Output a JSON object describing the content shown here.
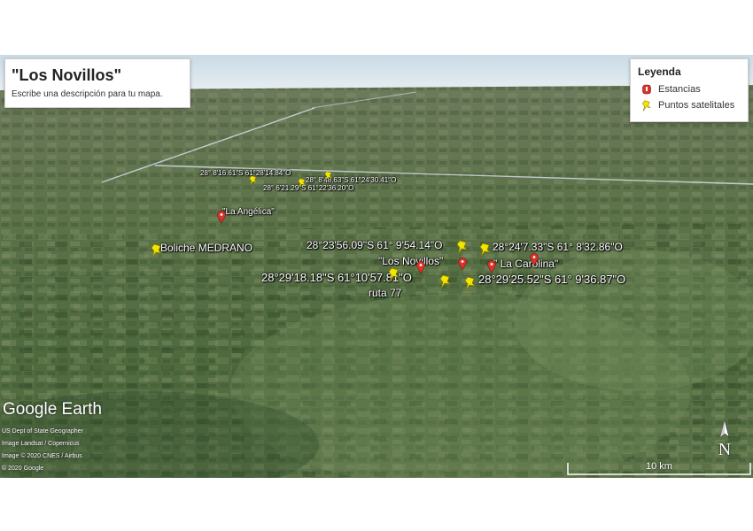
{
  "title_panel": {
    "title": "\"Los Novillos\"",
    "description": "Escribe una descripción para tu mapa."
  },
  "legend": {
    "heading": "Leyenda",
    "items": [
      {
        "label": "Estancias",
        "icon": "red-marker-icon",
        "color": "#d9332b"
      },
      {
        "label": "Puntos satelitales",
        "icon": "yellow-pushpin-icon",
        "color": "#f2e600"
      }
    ]
  },
  "map_labels": {
    "north_small_1": "28° 8'16.61\"S  61°28'14.84\"O",
    "north_small_2": "28° 8'48.63\"S  61°24'30.41\"O",
    "north_small_3": "28° 6'21.29\"S  61°22'36.20\"O",
    "la_angelica": "\"La Angélica\"",
    "boliche": "Boliche MEDRANO",
    "coord_center_top": "28°23'56.09\"S  61° 9'54.14\"O",
    "coord_right_top": "28°24'7.33\"S  61° 8'32.86\"O",
    "los_novillos": "\"Los Novillos\"",
    "la_carolina": "\" La Carolina\"",
    "coord_left_bottom": "28°29'18.18\"S  61°10'57.81\"O",
    "coord_right_bottom": "28°29'25.52\"S  61° 9'36.87\"O",
    "ruta": "ruta 77"
  },
  "branding": {
    "logo": "Google Earth",
    "credits": [
      "US Dept of State Geographer",
      "Image Landsat / Copernicus",
      "Image © 2020 CNES / Airbus",
      "© 2020 Google"
    ]
  },
  "compass": {
    "letter": "N"
  },
  "scale": {
    "label": "10 km"
  },
  "colors": {
    "sky": "#dfe9ee",
    "terrain_dark": "#3f5a34",
    "terrain_light": "#7d8f63",
    "pin": "#f2e600",
    "marker": "#d9332b"
  }
}
